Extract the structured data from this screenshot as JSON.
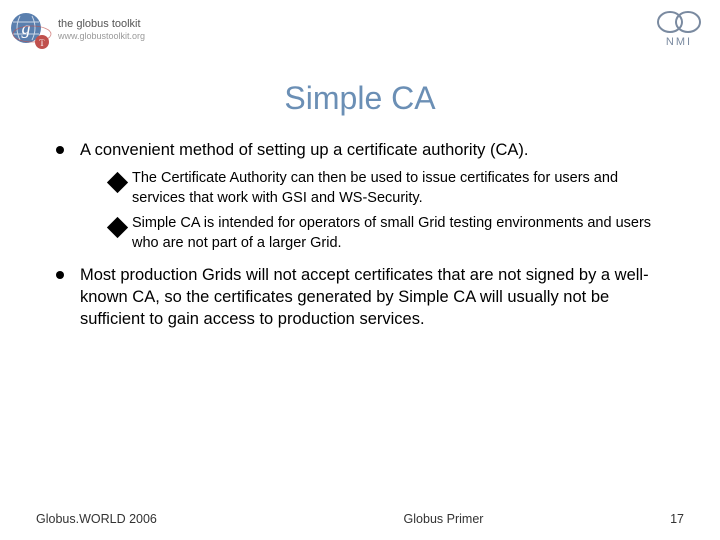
{
  "header": {
    "globus_toolkit_label": "the globus toolkit",
    "globus_url": "www.globustoolkit.org",
    "nmi_label": "NMI"
  },
  "title": "Simple CA",
  "bullets": [
    {
      "text": "A convenient method of setting up a certificate authority (CA).",
      "children": [
        "The Certificate Authority can then be used to issue certificates for users and services that work with GSI and WS-Security.",
        "Simple CA is intended for operators of small Grid testing environments and users who are not part of a larger Grid."
      ]
    },
    {
      "text": "Most production Grids will not accept certificates that are not signed by a well-known CA, so the certificates generated by Simple CA will usually not be sufficient to gain access to production services.",
      "children": []
    }
  ],
  "footer": {
    "left": "Globus.WORLD 2006",
    "center": "Globus Primer",
    "right": "17"
  }
}
